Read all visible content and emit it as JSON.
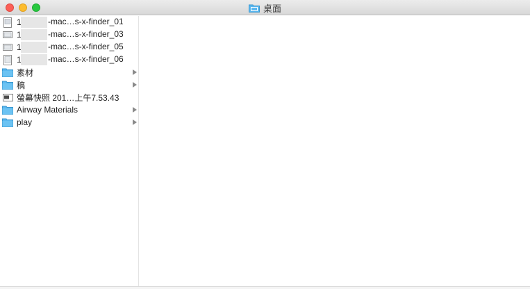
{
  "window": {
    "title": "桌面",
    "title_icon": "desktop-folder-icon"
  },
  "column": {
    "items": [
      {
        "prefix": "1",
        "label": "-mac…s-x-finder_01",
        "icon": "image-document-icon",
        "type": "file"
      },
      {
        "prefix": "1",
        "label": "-mac…s-x-finder_03",
        "icon": "image-document-icon",
        "type": "file"
      },
      {
        "prefix": "1",
        "label": "-mac…s-x-finder_05",
        "icon": "image-document-icon",
        "type": "file"
      },
      {
        "prefix": "1",
        "label": "-mac…s-x-finder_06",
        "icon": "image-document-icon",
        "type": "file"
      },
      {
        "label": "素材",
        "icon": "folder-icon",
        "type": "folder"
      },
      {
        "label": "稿",
        "icon": "folder-icon",
        "type": "folder"
      },
      {
        "label": "螢幕快照 201…上午7.53.43",
        "icon": "screenshot-file-icon",
        "type": "file"
      },
      {
        "label": "Airway Materials",
        "icon": "folder-icon",
        "type": "folder"
      },
      {
        "label": "play",
        "icon": "folder-icon",
        "type": "folder"
      }
    ]
  },
  "colors": {
    "folder": "#5ab7ef",
    "folder_tab": "#4aa7df",
    "close": "#fc5f57",
    "minimize": "#fdbc2e",
    "zoom": "#28c840"
  }
}
